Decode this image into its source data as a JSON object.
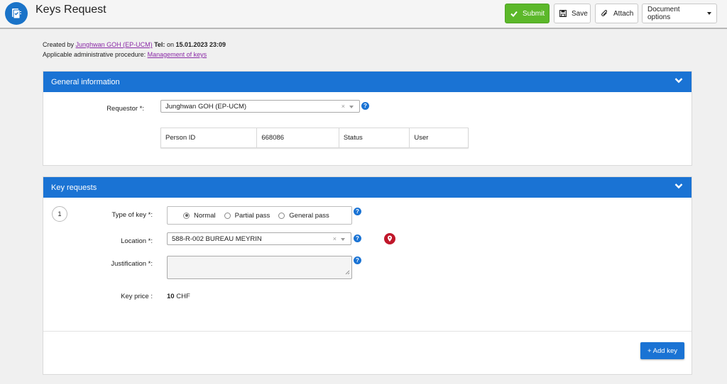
{
  "header": {
    "title": "Keys Request",
    "submit_label": "Submit",
    "save_label": "Save",
    "attach_label": "Attach",
    "document_options_label": "Document options"
  },
  "meta": {
    "created_by_prefix": "Created by",
    "creator_name": "Junghwan GOH (EP-UCM)",
    "tel_label": "Tel:",
    "on_text": "on",
    "created_datetime": "15.01.2023 23:09",
    "procedure_prefix": "Applicable administrative procedure:",
    "procedure_link": "Management of keys"
  },
  "general": {
    "title": "General information",
    "requestor_label": "Requestor *:",
    "requestor_value": "Junghwan GOH (EP-UCM)",
    "person_id_label": "Person ID",
    "person_id_value": "668086",
    "status_label": "Status",
    "status_value": "User"
  },
  "key_requests": {
    "title": "Key requests",
    "item_number": "1",
    "type_label": "Type of key *:",
    "type_options": [
      "Normal",
      "Partial pass",
      "General pass"
    ],
    "type_selected": "Normal",
    "location_label": "Location *:",
    "location_value": "588-R-002 BUREAU MEYRIN",
    "justification_label": "Justification *:",
    "justification_value": "",
    "price_label": "Key price :",
    "price_amount": "10",
    "price_currency": "CHF",
    "add_key_label": "+ Add key"
  },
  "colors": {
    "accent": "#1a73d4",
    "submit": "#5cb82a",
    "link": "#8a2aa6",
    "pin": "#c0172a"
  },
  "icons": [
    "app-document-icon",
    "checkmark-icon",
    "floppy-disk-icon",
    "paperclip-icon",
    "caret-down-icon",
    "chevron-down-icon",
    "help-icon",
    "map-pin-icon",
    "clear-icon"
  ]
}
